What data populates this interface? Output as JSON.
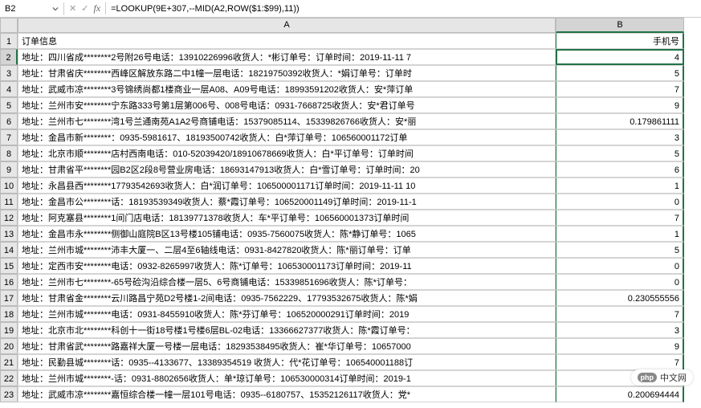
{
  "nameBox": "B2",
  "formula": "=LOOKUP(9E+307,--MID(A2,ROW($1:$99),11))",
  "columns": [
    "A",
    "B"
  ],
  "headers": {
    "colA": "订单信息",
    "colB": "手机号"
  },
  "rows": [
    {
      "n": 2,
      "a": "地址：四川省成********2号附26号电话：13910226996收货人：*彬订单号：订单时间：2019-11-11 7",
      "b": "4"
    },
    {
      "n": 3,
      "a": "地址：甘肃省庆********西峰区解放东路二中1幢一层电话：18219750392收货人：*娟订单号：订单时",
      "b": "5"
    },
    {
      "n": 4,
      "a": "地址：武威市凉********3号锦绣尚都1楼商业一层A08、A09号电话：18993591202收货人：安*萍订单",
      "b": "7"
    },
    {
      "n": 5,
      "a": "地址：兰州市安********宁东路333号第1层第006号、008号电话：0931-7668725收货人：安*君订单号",
      "b": "9"
    },
    {
      "n": 6,
      "a": "地址：兰州市七********湾1号兰通南苑A1A2号商铺电话：15379085114、15339826766收货人：安*丽",
      "b": "0.179861111"
    },
    {
      "n": 7,
      "a": "地址：金昌市新********：0935-5981617、18193500742收货人：白*萍订单号：106560001172订单",
      "b": "3"
    },
    {
      "n": 8,
      "a": "地址：北京市顺********店村西南电话：010-52039420/18910678669收货人：白*平订单号：订单时间",
      "b": "5"
    },
    {
      "n": 9,
      "a": "地址：甘肃省平********园B2区2段8号营业房电话：18693147913收货人：白*雪订单号：订单时间：20",
      "b": "6"
    },
    {
      "n": 10,
      "a": "地址：永昌县西********17793542693收货人：白*润订单号：106500001171订单时间：2019-11-11 10",
      "b": "1"
    },
    {
      "n": 11,
      "a": "地址：金昌市公********话：18193539349收货人：蔡*霞订单号：106520001149订单时间：2019-11-1",
      "b": "0"
    },
    {
      "n": 12,
      "a": "地址：阿克塞县********1间门店电话：18139771378收货人：车*平订单号：106560001373订单时间",
      "b": "7"
    },
    {
      "n": 13,
      "a": "地址：金昌市永********侧御山庭院B区13号楼105铺电话：0935-7560075收货人：陈*静订单号：1065",
      "b": "1"
    },
    {
      "n": 14,
      "a": "地址：兰州市城********沛丰大厦一、二层4至6轴线电话：0931-8427820收货人：陈*丽订单号：订单",
      "b": "5"
    },
    {
      "n": 15,
      "a": "地址：定西市安********电话：0932-8265997收货人：陈*订单号：106530001173订单时间：2019-11",
      "b": "0"
    },
    {
      "n": 16,
      "a": "地址：兰州市七********-65号硷沟沿综合楼一层5、6号商铺电话：15339851696收货人：陈*订单号：",
      "b": "0"
    },
    {
      "n": 17,
      "a": "地址：甘肃省金********云川路昌宁苑D2号楼1-2间电话：0935-7562229、17793532675收货人：陈*娟",
      "b": "0.230555556"
    },
    {
      "n": 18,
      "a": "地址：兰州市城********电话：0931-8455910收货人：陈*芬订单号：106520000291订单时间：2019",
      "b": "7"
    },
    {
      "n": 19,
      "a": "地址：北京市北********科创十一街18号楼1号楼6层BL-02电话：13366627377收货人：陈*霞订单号：",
      "b": "3"
    },
    {
      "n": 20,
      "a": "地址：甘肃省武********路嘉祥大厦一号楼一层电话：18293538495收货人：崔*华订单号：10657000",
      "b": "9"
    },
    {
      "n": 21,
      "a": "地址：民勤县城********话：0935--4133677、13389354519  收货人：代*花订单号：106540001188订",
      "b": "7"
    },
    {
      "n": 22,
      "a": "地址：兰州市城********-话：0931-8802656收货人：单*琼订单号：106530000314订单时间：2019-1",
      "b": "0"
    },
    {
      "n": 23,
      "a": "地址：武威市凉********嘉恒综合楼一幢一层101号电话：0935--6180757、15352126117收货人：党*",
      "b": "0.200694444"
    }
  ],
  "watermark": {
    "badge": "php",
    "text": "中文网"
  }
}
